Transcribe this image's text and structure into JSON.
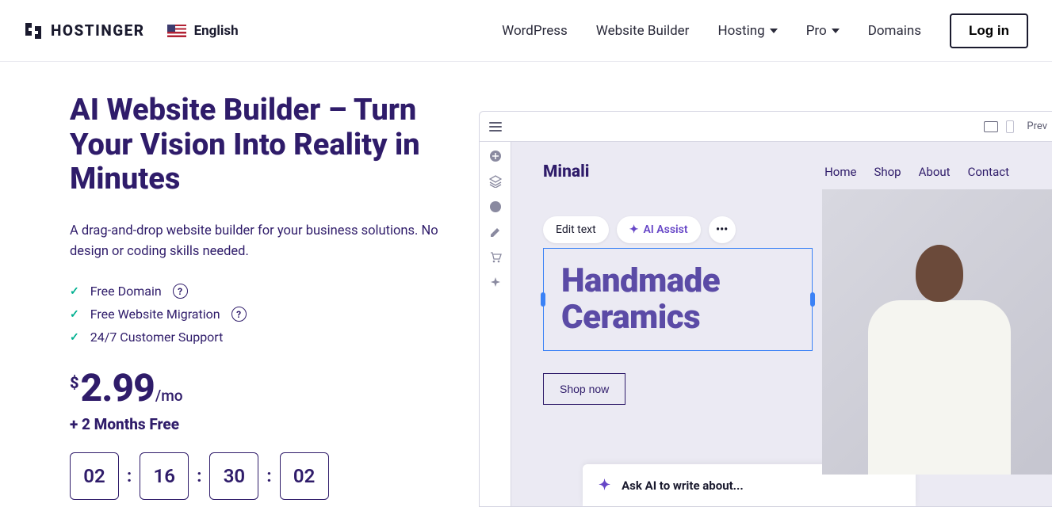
{
  "header": {
    "logo_text": "HOSTINGER",
    "language": "English",
    "nav": {
      "wordpress": "WordPress",
      "website_builder": "Website Builder",
      "hosting": "Hosting",
      "pro": "Pro",
      "domains": "Domains"
    },
    "login": "Log in"
  },
  "hero": {
    "title": "AI Website Builder – Turn Your Vision Into Reality in Minutes",
    "subtitle": "A drag-and-drop website builder for your business solutions. No design or coding skills needed.",
    "features": {
      "free_domain": "Free Domain",
      "free_migration": "Free Website Migration",
      "support": "24/7 Customer Support"
    },
    "currency": "$",
    "price": "2.99",
    "per": "/mo",
    "bonus": "+ 2 Months Free",
    "countdown": {
      "days": "02",
      "hours": "16",
      "minutes": "30",
      "seconds": "02"
    }
  },
  "preview": {
    "top_label": "Prev",
    "site_brand": "Minali",
    "site_nav": {
      "home": "Home",
      "shop": "Shop",
      "about": "About",
      "contact": "Contact"
    },
    "toolbar": {
      "edit_text": "Edit text",
      "ai_assist": "AI Assist",
      "more": "•••"
    },
    "hero_text": "Handmade Ceramics",
    "shop_now": "Shop now",
    "ai_prompt": "Ask AI to write about..."
  }
}
